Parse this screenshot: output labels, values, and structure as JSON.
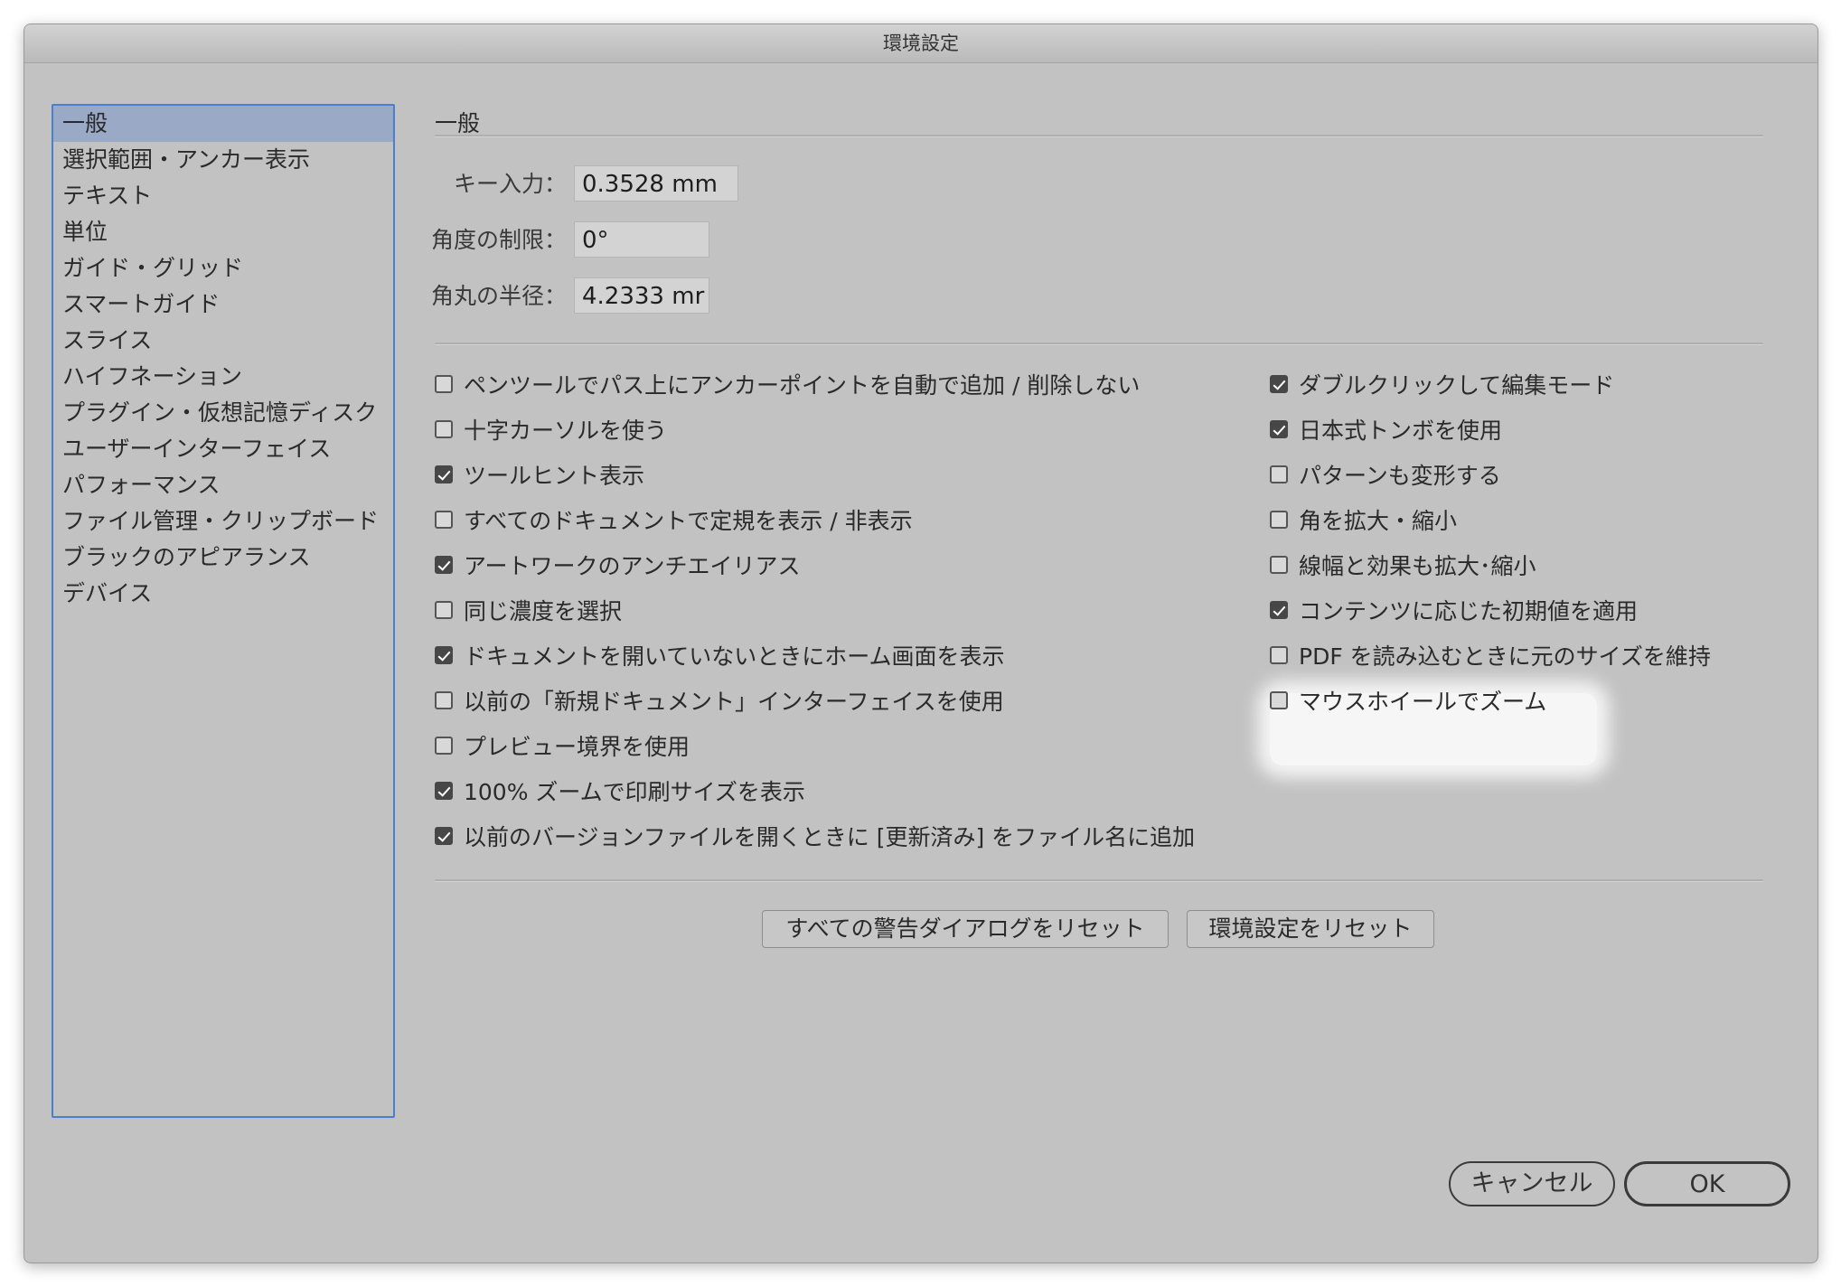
{
  "window": {
    "title": "環境設定"
  },
  "sidebar": {
    "items": [
      {
        "label": "一般",
        "selected": true
      },
      {
        "label": "選択範囲・アンカー表示"
      },
      {
        "label": "テキスト"
      },
      {
        "label": "単位"
      },
      {
        "label": "ガイド・グリッド"
      },
      {
        "label": "スマートガイド"
      },
      {
        "label": "スライス"
      },
      {
        "label": "ハイフネーション"
      },
      {
        "label": "プラグイン・仮想記憶ディスク"
      },
      {
        "label": "ユーザーインターフェイス"
      },
      {
        "label": "パフォーマンス"
      },
      {
        "label": "ファイル管理・クリップボード"
      },
      {
        "label": "ブラックのアピアランス"
      },
      {
        "label": "デバイス"
      }
    ]
  },
  "main": {
    "section_title": "一般",
    "fields": [
      {
        "label": "キー入力：",
        "value": "0.3528 mm"
      },
      {
        "label": "角度の制限：",
        "value": "0°"
      },
      {
        "label": "角丸の半径：",
        "value": "4.2333 mr"
      }
    ],
    "left_options": [
      {
        "label": "ペンツールでパス上にアンカーポイントを自動で追加 / 削除しない",
        "checked": false
      },
      {
        "label": "十字カーソルを使う",
        "checked": false
      },
      {
        "label": "ツールヒント表示",
        "checked": true
      },
      {
        "label": "すべてのドキュメントで定規を表示 / 非表示",
        "checked": false
      },
      {
        "label": "アートワークのアンチエイリアス",
        "checked": true
      },
      {
        "label": "同じ濃度を選択",
        "checked": false
      },
      {
        "label": "ドキュメントを開いていないときにホーム画面を表示",
        "checked": true
      },
      {
        "label": "以前の「新規ドキュメント」インターフェイスを使用",
        "checked": false
      },
      {
        "label": "プレビュー境界を使用",
        "checked": false
      },
      {
        "label": "100% ズームで印刷サイズを表示",
        "checked": true
      },
      {
        "label": "以前のバージョンファイルを開くときに [更新済み] をファイル名に追加",
        "checked": true
      }
    ],
    "right_options": [
      {
        "label": "ダブルクリックして編集モード",
        "checked": true
      },
      {
        "label": "日本式トンボを使用",
        "checked": true
      },
      {
        "label": "パターンも変形する",
        "checked": false
      },
      {
        "label": "角を拡大・縮小",
        "checked": false
      },
      {
        "label": "線幅と効果も拡大･縮小",
        "checked": false
      },
      {
        "label": "コンテンツに応じた初期値を適用",
        "checked": true
      },
      {
        "label": "PDF を読み込むときに元のサイズを維持",
        "checked": false
      },
      {
        "label": "マウスホイールでズーム",
        "checked": false
      }
    ],
    "reset_warnings_label": "すべての警告ダイアログをリセット",
    "reset_prefs_label": "環境設定をリセット"
  },
  "footer": {
    "cancel_label": "キャンセル",
    "ok_label": "OK"
  }
}
